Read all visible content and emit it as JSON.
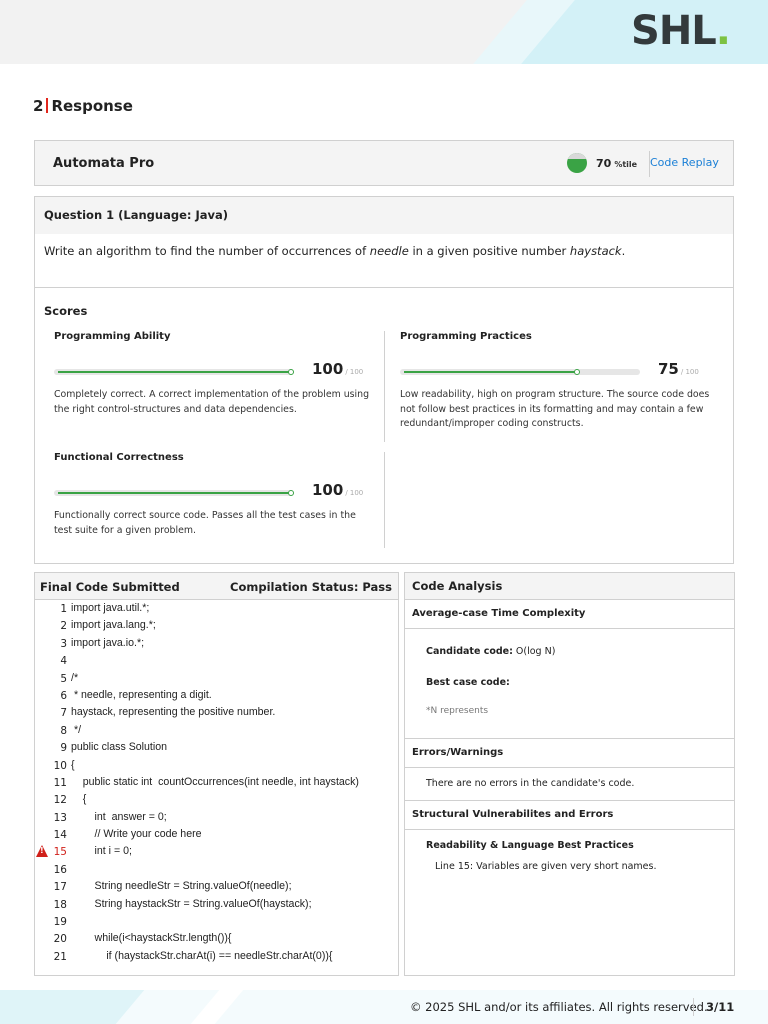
{
  "brand": {
    "logo_text": "SHL",
    "logo_dot": ".",
    "accent_color": "#7dc242"
  },
  "section": {
    "number": "2",
    "title": "Response"
  },
  "product": {
    "name": "Automata Pro",
    "percentile": "70",
    "percentile_unit": "%tile",
    "percentile_fraction": 0.7,
    "code_replay_label": "Code Replay"
  },
  "question": {
    "heading": "Question 1 (Language: Java)",
    "text_before_needle": "Write an algorithm to find the number of occurrences of ",
    "needle": "needle",
    "text_middle": " in a given positive number ",
    "haystack": "haystack",
    "text_end": "."
  },
  "scores": {
    "title": "Scores",
    "items": [
      {
        "name": "Programming Ability",
        "value": "100",
        "max": "/ 100",
        "fraction": 1.0,
        "description": "Completely correct. A correct implementation of the problem using the right control-structures and data dependencies."
      },
      {
        "name": "Programming Practices",
        "value": "75",
        "max": "/ 100",
        "fraction": 0.75,
        "description": "Low readability, high on program structure. The source code does not follow best practices in its formatting and may contain a few redundant/improper coding constructs."
      },
      {
        "name": "Functional Correctness",
        "value": "100",
        "max": "/ 100",
        "fraction": 1.0,
        "description": "Functionally correct source code. Passes all the test cases in the test suite for a given problem."
      }
    ]
  },
  "code": {
    "title": "Final Code Submitted",
    "compilation_status": "Compilation Status: Pass",
    "lines": [
      {
        "num": "1",
        "text": "import java.util.*;"
      },
      {
        "num": "2",
        "text": "import java.lang.*;"
      },
      {
        "num": "3",
        "text": "import java.io.*;"
      },
      {
        "num": "4",
        "text": ""
      },
      {
        "num": "5",
        "text": "/*"
      },
      {
        "num": "6",
        "text": " * needle, representing a digit."
      },
      {
        "num": "7",
        "text": "haystack, representing the positive number."
      },
      {
        "num": "8",
        "text": " */"
      },
      {
        "num": "9",
        "text": "public class Solution"
      },
      {
        "num": "10",
        "text": "{"
      },
      {
        "num": "11",
        "text": "    public static int  countOccurrences(int needle, int haystack)"
      },
      {
        "num": "12",
        "text": "    {"
      },
      {
        "num": "13",
        "text": "        int  answer = 0;"
      },
      {
        "num": "14",
        "text": "        // Write your code here"
      },
      {
        "num": "15",
        "text": "        int i = 0;",
        "warning": true
      },
      {
        "num": "16",
        "text": ""
      },
      {
        "num": "17",
        "text": "        String needleStr = String.valueOf(needle);"
      },
      {
        "num": "18",
        "text": "        String haystackStr = String.valueOf(haystack);"
      },
      {
        "num": "19",
        "text": ""
      },
      {
        "num": "20",
        "text": "        while(i<haystackStr.length()){"
      },
      {
        "num": "21",
        "text": "            if (haystackStr.charAt(i) == needleStr.charAt(0)){"
      }
    ]
  },
  "analysis": {
    "title": "Code Analysis",
    "time_complexity_title": "Average-case Time Complexity",
    "candidate_code_label": "Candidate code:",
    "candidate_code_value": " O(log N)",
    "best_case_label": "Best case code:",
    "best_case_value": "",
    "n_note": "*N represents",
    "errors_title": "Errors/Warnings",
    "errors_text": "There are no errors in the candidate's code.",
    "structural_title": "Structural Vulnerabilites and Errors",
    "readability_title": "Readability & Language Best Practices",
    "readability_text": "Line 15: Variables are given very short names."
  },
  "footer": {
    "copyright": "© 2025 SHL and/or its affiliates. All rights reserved.",
    "page": "3/11"
  }
}
